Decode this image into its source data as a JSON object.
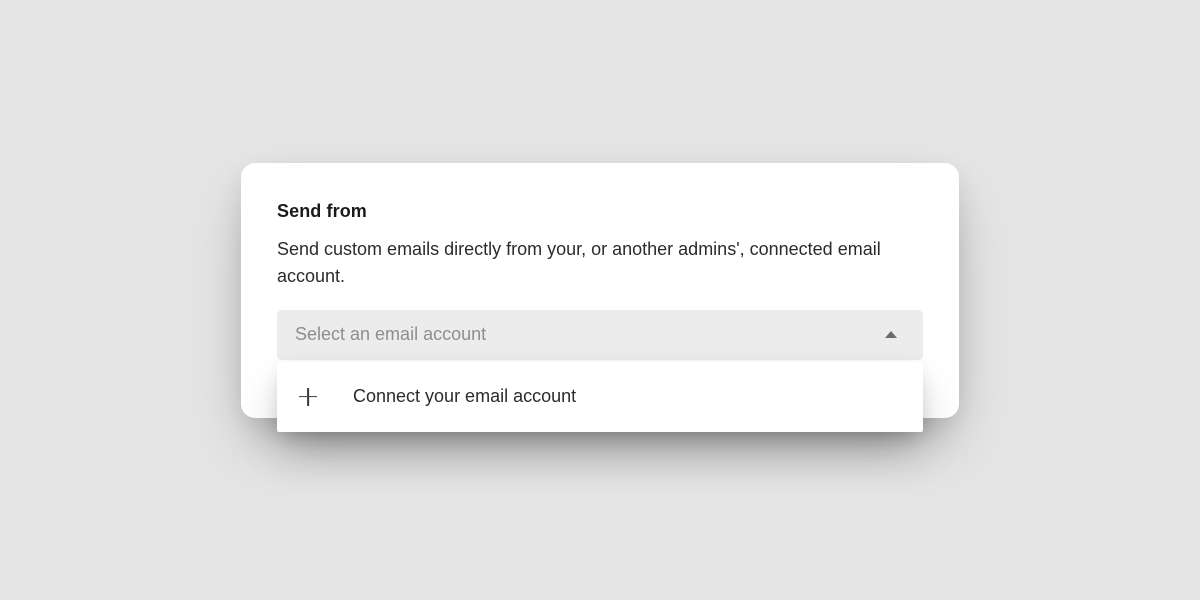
{
  "card": {
    "title": "Send from",
    "description": "Send custom emails directly from your, or another admins', connected email account."
  },
  "select": {
    "placeholder": "Select an email account",
    "expanded": true
  },
  "dropdown": {
    "connect_option": "Connect your email account"
  }
}
